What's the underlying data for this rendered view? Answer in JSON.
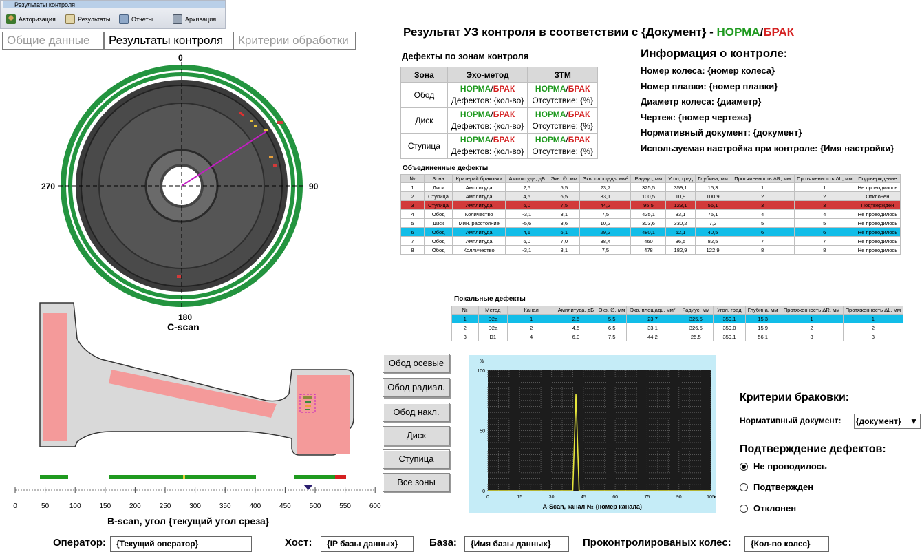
{
  "window": {
    "title": "Результаты контроля"
  },
  "toolbar": {
    "auth": "Авторизация",
    "results": "Результаты",
    "reports": "Отчеты",
    "archive": "Архивация"
  },
  "tabs": [
    {
      "label": "Общие данные",
      "active": false
    },
    {
      "label": "Результаты контроля",
      "active": true
    },
    {
      "label": "Критерии обработки",
      "active": false
    }
  ],
  "heading": {
    "prefix": "Результат УЗ контроля  в соответствии с {Документ} -",
    "ok": "НОРМА",
    "slash": "/",
    "bad": "БРАК"
  },
  "zones": {
    "title": "Дефекты по зонам контроля",
    "headers": [
      "Зона",
      "Эхо-метод",
      "ЗТМ"
    ],
    "rows": [
      {
        "zone": "Обод",
        "echo": "Дефектов: {кол-во}",
        "ztm": "Отсутствие: {%}"
      },
      {
        "zone": "Диск",
        "echo": "Дефектов: {кол-во}",
        "ztm": "Отсутствие: {%}"
      },
      {
        "zone": "Ступица",
        "echo": "Дефектов: {кол-во}",
        "ztm": "Отсутствие: {%}"
      }
    ],
    "ok": "НОРМА",
    "bad": "БРАК",
    "slash": "/"
  },
  "info": {
    "title": "Информация о контроле:",
    "lines": [
      "Номер колеса: {номер колеса}",
      "Номер плавки: {номер плавки}",
      "Диаметр колеса: {диаметр}",
      "Чертеж: {номер чертежа}",
      "Нормативный документ: {документ}",
      "Используемая настройка при контроле: {Имя настройки}"
    ]
  },
  "combined": {
    "title": "Объединенные дефекты",
    "headers": [
      "№",
      "Зона",
      "Критерий браковки",
      "Амплитуда, дБ",
      "Экв. ∅, мм",
      "Экв. площадь, мм²",
      "Радиус, мм",
      "Угол, град",
      "Глубина, мм",
      "Протяженность ΔR, мм",
      "Протяженность ΔL, мм",
      "Подтверждение"
    ],
    "rows": [
      [
        "1",
        "Диск",
        "Амплитуда",
        "2,5",
        "5,5",
        "23,7",
        "325,5",
        "359,1",
        "15,3",
        "1",
        "1",
        "Не проводилось"
      ],
      [
        "2",
        "Ступица",
        "Амплитуда",
        "4,5",
        "6,5",
        "33,1",
        "100,5",
        "10,9",
        "100,9",
        "2",
        "2",
        "Отклонен"
      ],
      [
        "3",
        "Ступица",
        "Амплитуда",
        "6,0",
        "7,5",
        "44,2",
        "95,5",
        "123,1",
        "56,1",
        "3",
        "3",
        "Подтвержден"
      ],
      [
        "4",
        "Обод",
        "Количество",
        "-3,1",
        "3,1",
        "7,5",
        "425,1",
        "33,1",
        "75,1",
        "4",
        "4",
        "Не проводилось"
      ],
      [
        "5",
        "Диск",
        "Мин. расстояние",
        "-5,6",
        "3,6",
        "10,2",
        "303,6",
        "330,2",
        "7,2",
        "5",
        "5",
        "Не проводилось"
      ],
      [
        "6",
        "Обод",
        "Амплитуда",
        "4,1",
        "6,1",
        "29,2",
        "480,1",
        "52,1",
        "40,5",
        "6",
        "6",
        "Не проводилось"
      ],
      [
        "7",
        "Обод",
        "Амплитуда",
        "6,0",
        "7,0",
        "38,4",
        "460",
        "36,5",
        "82,5",
        "7",
        "7",
        "Не проводилось"
      ],
      [
        "8",
        "Обод",
        "Колличество",
        "-3,1",
        "3,1",
        "7,5",
        "478",
        "182,9",
        "122,9",
        "8",
        "8",
        "Не проводилось"
      ]
    ],
    "row_states": [
      "",
      "grey",
      "red",
      "",
      "",
      "cyan",
      "",
      ""
    ]
  },
  "local": {
    "title": "Покальные дефекты",
    "headers": [
      "№",
      "Метод",
      "Канал",
      "Амплитуда, дБ",
      "Экв. ∅, мм",
      "Экв. площадь, мм²",
      "Радиус, мм",
      "Угол, град",
      "Глубина, мм",
      "Протяженность ΔR, мм",
      "Протяженность ΔL, мм"
    ],
    "rows": [
      [
        "1",
        "D2a",
        "1",
        "2,5",
        "5,5",
        "23,7",
        "325,5",
        "359,1",
        "15,3",
        "1",
        "1"
      ],
      [
        "2",
        "D2a",
        "2",
        "4,5",
        "6,5",
        "33,1",
        "326,5",
        "359,0",
        "15,9",
        "2",
        "2"
      ],
      [
        "3",
        "D1",
        "4",
        "6,0",
        "7,5",
        "44,2",
        "25,5",
        "359,1",
        "56,1",
        "3",
        "3"
      ]
    ],
    "row_states": [
      "cyan",
      "",
      ""
    ]
  },
  "cscan": {
    "label": "C-scan",
    "top": "0",
    "bottom": "180",
    "left": "270",
    "right": "90"
  },
  "bscan": {
    "label": "B-scan, угол {текущий угол среза}",
    "ticks": [
      "0",
      "50",
      "100",
      "150",
      "200",
      "250",
      "300",
      "350",
      "400",
      "450",
      "500",
      "550",
      "600"
    ]
  },
  "zone_buttons": [
    "Обод осевые",
    "Обод радиал.",
    "Обод накл.",
    "Диск",
    "Ступица",
    "Все зоны"
  ],
  "ascan": {
    "label": "A-Scan, канал № {номер канала}",
    "y_unit": "%",
    "x_unit": "мм",
    "y_ticks": [
      "100",
      "50",
      "0"
    ],
    "x_ticks": [
      "0",
      "15",
      "30",
      "45",
      "60",
      "75",
      "90",
      "105"
    ]
  },
  "chart_data": {
    "type": "line",
    "title": "A-Scan, канал № {номер канала}",
    "xlabel": "мм",
    "ylabel": "%",
    "xlim": [
      0,
      105
    ],
    "ylim": [
      0,
      100
    ],
    "series": [
      {
        "x": [
          0,
          38,
          40,
          41.5,
          43,
          44.5,
          46,
          105
        ],
        "y": [
          0,
          0,
          0,
          80,
          0,
          0,
          0,
          0
        ],
        "color": "#e6e63c"
      }
    ],
    "grid": true
  },
  "criteria": {
    "title": "Критерии браковки:",
    "doc_label": "Нормативный документ:",
    "doc_value": "{документ}",
    "confirm_title": "Подтверждение дефектов:",
    "options": [
      {
        "label": "Не проводилось",
        "checked": true
      },
      {
        "label": "Подтвержден",
        "checked": false
      },
      {
        "label": "Отклонен",
        "checked": false
      }
    ]
  },
  "footer": {
    "operator_label": "Оператор:",
    "operator_value": "{Текущий оператор}",
    "host_label": "Хост:",
    "host_value": "{IP базы данных}",
    "db_label": "База:",
    "db_value": "{Имя базы данных}",
    "count_label": "Проконтролированых колес:",
    "count_value": "{Кол-во колес}"
  },
  "colors": {
    "ok": "#1f9a1f",
    "bad": "#d42020",
    "scan_ring": "#23943f",
    "highlight_red": "#d23a3a",
    "highlight_cyan": "#12bde8",
    "ascan_bg": "#c5ecf7"
  }
}
